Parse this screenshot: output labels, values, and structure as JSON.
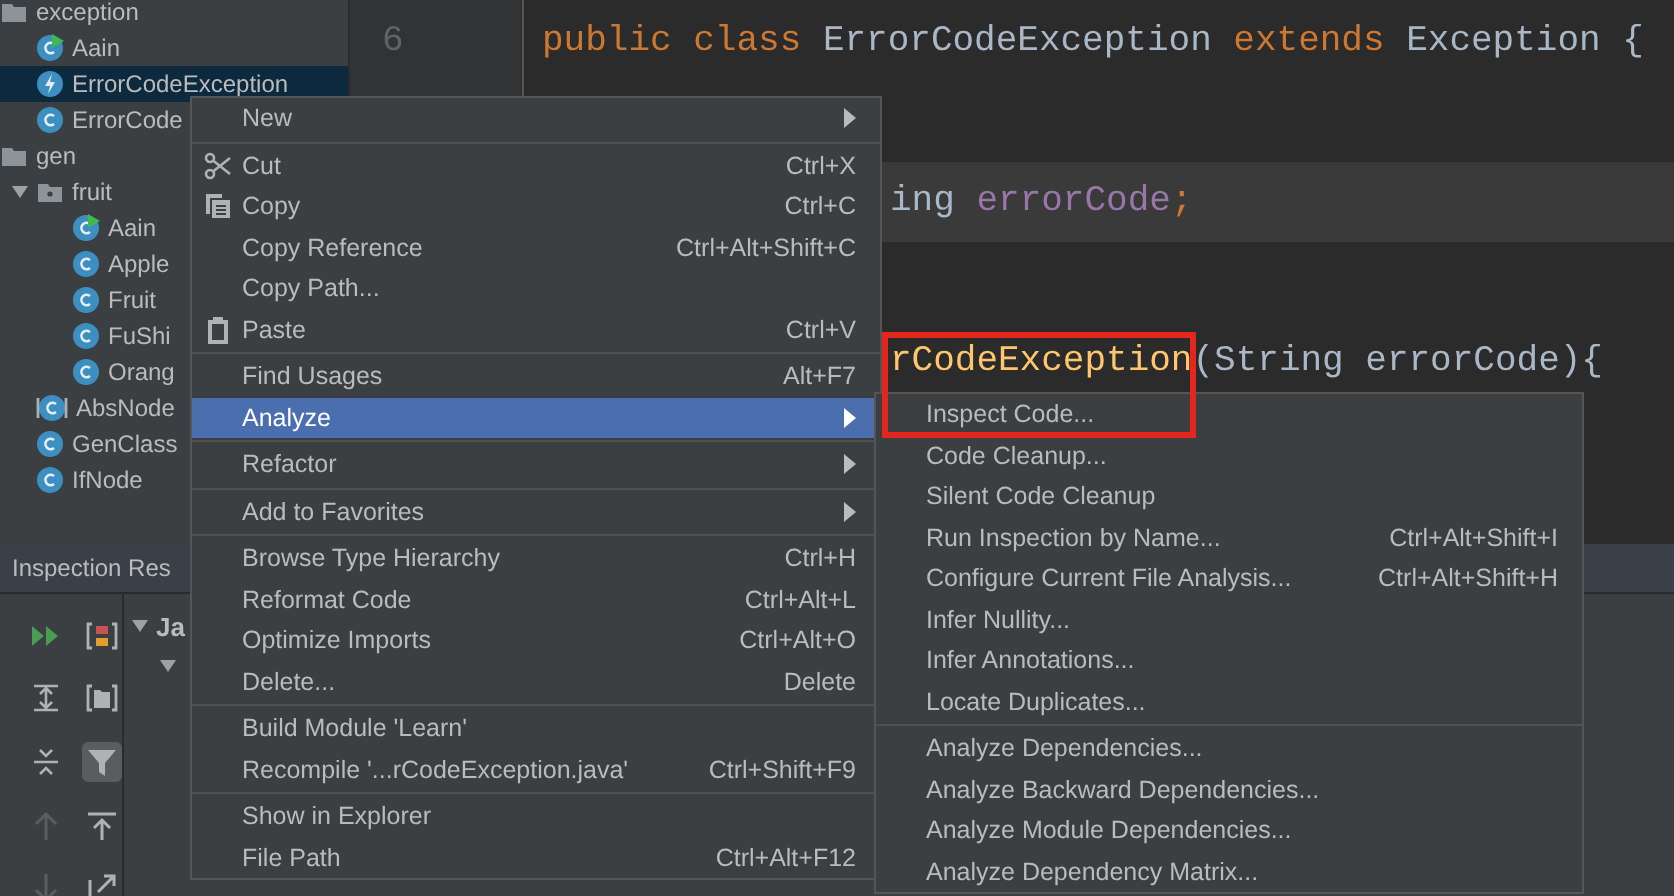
{
  "project_tree": [
    {
      "label": "exception",
      "kind": "folder",
      "selected": false,
      "children": [
        {
          "label": "Aain",
          "kind": "runnable-class",
          "selected": false
        },
        {
          "label": "ErrorCodeException",
          "kind": "exception-class",
          "selected": true
        },
        {
          "label": "ErrorCode",
          "kind": "class",
          "selected": false
        }
      ]
    },
    {
      "label": "gen",
      "kind": "folder",
      "selected": false,
      "children": [
        {
          "label": "fruit",
          "kind": "package",
          "expanded": true,
          "selected": false,
          "children": [
            {
              "label": "Aain",
              "kind": "runnable-class",
              "selected": false
            },
            {
              "label": "Apple",
              "kind": "class",
              "selected": false
            },
            {
              "label": "Fruit",
              "kind": "class",
              "selected": false
            },
            {
              "label": "FuShi",
              "kind": "class",
              "selected": false
            },
            {
              "label": "Orang",
              "kind": "class",
              "selected": false
            }
          ]
        },
        {
          "label": "AbsNode",
          "kind": "abstract-class",
          "selected": false
        },
        {
          "label": "GenClass",
          "kind": "class",
          "selected": false
        },
        {
          "label": "IfNode",
          "kind": "class",
          "selected": false
        }
      ]
    }
  ],
  "editor": {
    "lines": [
      {
        "number": "6",
        "partial": false,
        "current": false,
        "tokens": [
          {
            "text": "public class ",
            "kind": "keyword"
          },
          {
            "text": "ErrorCodeException ",
            "kind": "plain"
          },
          {
            "text": "extends ",
            "kind": "keyword"
          },
          {
            "text": "Exception {",
            "kind": "plain"
          }
        ]
      },
      {
        "partial": true,
        "current": true,
        "tokens": [
          {
            "text": "ing ",
            "kind": "plain"
          },
          {
            "text": "errorCode",
            "kind": "field"
          },
          {
            "text": ";",
            "kind": "keyword"
          }
        ]
      },
      {
        "partial": true,
        "current": false,
        "tokens": [
          {
            "text": "rCodeException",
            "kind": "method"
          },
          {
            "text": "(String errorCode){",
            "kind": "plain"
          }
        ]
      }
    ]
  },
  "inspection_panel": {
    "title": "Inspection Res",
    "tree": [
      {
        "label": "Ja",
        "expanded": true
      }
    ]
  },
  "context_menu": {
    "groups": [
      [
        {
          "label": "New",
          "submenu": true,
          "selected": false
        }
      ],
      [
        {
          "label": "Cut",
          "shortcut": "Ctrl+X",
          "selected": false
        },
        {
          "label": "Copy",
          "shortcut": "Ctrl+C",
          "selected": false
        },
        {
          "label": "Copy Reference",
          "shortcut": "Ctrl+Alt+Shift+C",
          "selected": false
        },
        {
          "label": "Copy Path...",
          "selected": false
        },
        {
          "label": "Paste",
          "shortcut": "Ctrl+V",
          "selected": false
        }
      ],
      [
        {
          "label": "Find Usages",
          "shortcut": "Alt+F7",
          "selected": false
        },
        {
          "label": "Analyze",
          "submenu": true,
          "selected": true
        }
      ],
      [
        {
          "label": "Refactor",
          "submenu": true,
          "selected": false
        }
      ],
      [
        {
          "label": "Add to Favorites",
          "submenu": true,
          "selected": false
        }
      ],
      [
        {
          "label": "Browse Type Hierarchy",
          "shortcut": "Ctrl+H",
          "selected": false
        },
        {
          "label": "Reformat Code",
          "shortcut": "Ctrl+Alt+L",
          "selected": false
        },
        {
          "label": "Optimize Imports",
          "shortcut": "Ctrl+Alt+O",
          "selected": false
        },
        {
          "label": "Delete...",
          "shortcut": "Delete",
          "selected": false
        }
      ],
      [
        {
          "label": "Build Module 'Learn'",
          "selected": false
        },
        {
          "label": "Recompile '...rCodeException.java'",
          "shortcut": "Ctrl+Shift+F9",
          "selected": false
        }
      ],
      [
        {
          "label": "Show in Explorer",
          "selected": false
        },
        {
          "label": "File Path",
          "shortcut": "Ctrl+Alt+F12",
          "selected": false
        }
      ]
    ]
  },
  "analyze_submenu": {
    "groups": [
      [
        {
          "label": "Inspect Code...",
          "selected": false,
          "highlighted": true
        },
        {
          "label": "Code Cleanup...",
          "selected": false
        },
        {
          "label": "Silent Code Cleanup",
          "selected": false
        },
        {
          "label": "Run Inspection by Name...",
          "shortcut": "Ctrl+Alt+Shift+I",
          "selected": false
        },
        {
          "label": "Configure Current File Analysis...",
          "shortcut": "Ctrl+Alt+Shift+H",
          "selected": false
        },
        {
          "label": "Infer Nullity...",
          "selected": false
        },
        {
          "label": "Infer Annotations...",
          "selected": false
        },
        {
          "label": "Locate Duplicates...",
          "selected": false
        }
      ],
      [
        {
          "label": "Analyze Dependencies...",
          "selected": false
        },
        {
          "label": "Analyze Backward Dependencies...",
          "selected": false
        },
        {
          "label": "Analyze Module Dependencies...",
          "selected": false
        },
        {
          "label": "Analyze Dependency Matrix...",
          "selected": false
        }
      ]
    ]
  }
}
